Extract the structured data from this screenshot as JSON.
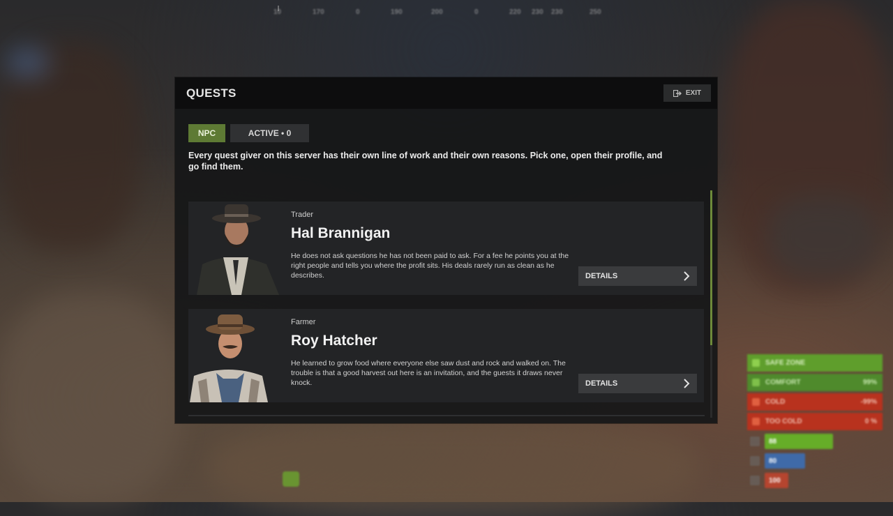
{
  "compass": [
    "10",
    "170",
    "0",
    "190",
    "200",
    "0",
    "220",
    "230",
    "230",
    "250"
  ],
  "panel": {
    "title": "QUESTS",
    "exit_label": "EXIT",
    "tabs": [
      {
        "label": "NPC",
        "active": true
      },
      {
        "label": "ACTIVE • 0",
        "active": false
      }
    ],
    "intro": "Every quest giver on this server has their own line of work and their own reasons. Pick one, open their profile, and go find them."
  },
  "npcs": [
    {
      "role": "Trader",
      "name": "Hal Brannigan",
      "description": "He does not ask questions he has not been paid to ask. For a fee he points you at the right people and tells you where the profit sits. His deals rarely run as clean as he describes.",
      "button_label": "DETAILS"
    },
    {
      "role": "Farmer",
      "name": "Roy Hatcher",
      "description": "He learned to grow food where everyone else saw dust and rock and walked on. The trouble is that a good harvest out here is an invitation, and the guests it draws never knock.",
      "button_label": "DETAILS"
    }
  ],
  "hud": {
    "safe_zone": {
      "label": "SAFE ZONE",
      "color": "#5f9e2c"
    },
    "comfort": {
      "label": "COMFORT",
      "value": "99%",
      "color": "#4f8a2c"
    },
    "cold": {
      "label": "COLD",
      "value": "-99%",
      "color": "#b8321e"
    },
    "too_cold": {
      "label": "TOO COLD",
      "value": "0 %",
      "color": "#b8321e"
    },
    "health": {
      "value": "88",
      "level": 0.74,
      "color": "#66ad28"
    },
    "hydration": {
      "value": "80",
      "level": 0.44,
      "color": "#3f6aa8"
    },
    "food": {
      "value": "100",
      "level": 0.5,
      "color": "#b5452f"
    }
  },
  "colors": {
    "accent_green": "#5e7a34",
    "panel_bg": "#161718",
    "card_bg": "#232426",
    "button_bg": "#3a3b3d"
  }
}
